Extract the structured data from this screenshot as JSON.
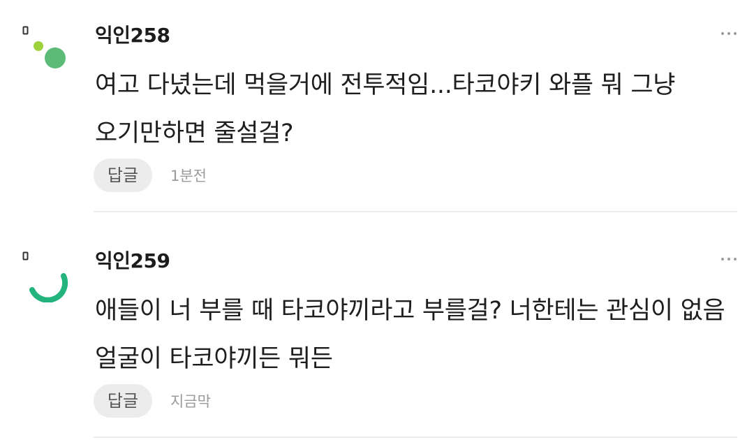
{
  "comments": [
    {
      "nickname": "익인258",
      "text": "여고 다녔는데 먹을거에 전투적임...타코야키 와플 뭐 그냥 오기만하면 줄설걸?",
      "reply_label": "답글",
      "timestamp": "1분전",
      "avatar_icon": "avatar-dots-icon",
      "more_icon": "more-horizontal-icon"
    },
    {
      "nickname": "익인259",
      "text": "애들이 너 부를 때 타코야끼라고 부를걸? 너한테는 관심이 없음 얼굴이 타코야끼든 뭐든",
      "reply_label": "답글",
      "timestamp": "지금막",
      "avatar_icon": "avatar-arc-icon",
      "more_icon": "more-horizontal-icon"
    }
  ],
  "colors": {
    "avatar_green": "#5dbb78",
    "avatar_lime": "#9ed23c",
    "avatar_teal": "#22b47c",
    "divider": "#ececec",
    "reply_bg": "#ececec",
    "timestamp": "#9a9a9a"
  }
}
